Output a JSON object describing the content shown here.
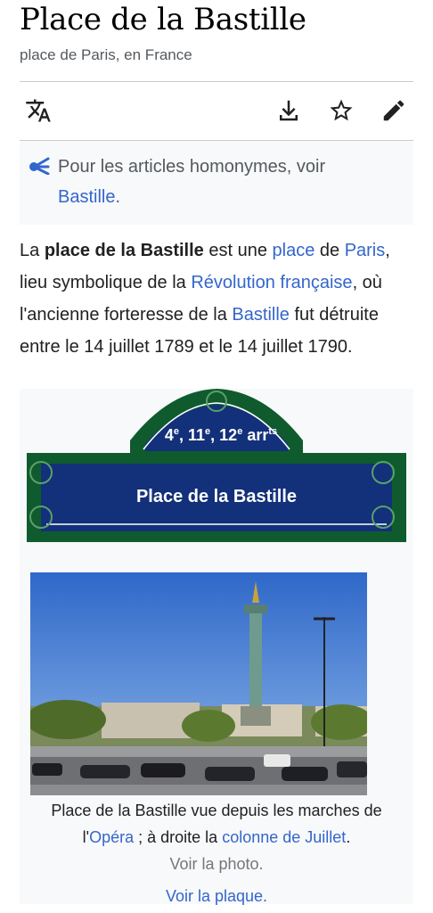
{
  "page": {
    "title": "Place de la Bastille",
    "subtitle": "place de Paris, en France"
  },
  "toolbar": {
    "language_icon": "translate-icon",
    "download_icon": "download-icon",
    "watch_icon": "star-icon",
    "edit_icon": "pencil-icon"
  },
  "hatnote": {
    "icon": "disambiguation-icon",
    "text": "Pour les articles homonymes, voir",
    "link": "Bastille",
    "suffix": "."
  },
  "lead": {
    "t1": "La ",
    "bold": "place de la Bastille",
    "t2": " est une ",
    "l1": "place",
    "t3": " de ",
    "l2": "Paris",
    "t4": ", lieu symbolique de la ",
    "l3": "Révolution française",
    "t5": ", où l'ancienne forteresse de la ",
    "l4": "Bastille",
    "t6": " fut détruite entre le 14 juillet 1789 et le 14 juillet 1790."
  },
  "infobox": {
    "sign": {
      "arr1": "4",
      "arr2": ", 11",
      "arr3": ", 12",
      "arr4": " arr",
      "sup_e": "e",
      "sup_ts": "ts",
      "name": "Place de la Bastille"
    },
    "caption": {
      "t1": "Place de la Bastille vue depuis les marches de l'",
      "l1": "Opéra",
      "t2": " ; à droite la ",
      "l2": "colonne de Juillet",
      "t3": ".",
      "photo_link": "Voir la photo.",
      "plaque_link": "Voir la plaque."
    }
  },
  "colors": {
    "link": "#3366cc",
    "sign_green": "#0f5b2e",
    "sign_blue": "#13307a",
    "hatnote_bg": "#f8f9fa"
  }
}
